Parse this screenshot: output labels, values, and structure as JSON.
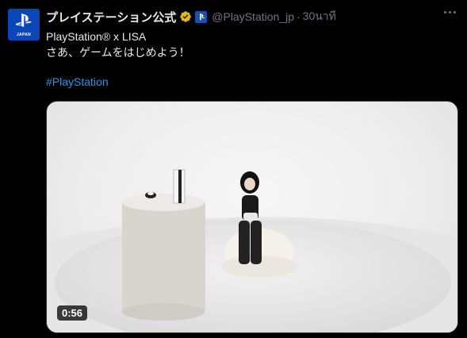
{
  "account": {
    "display_name": "プレイステーション公式",
    "handle": "@PlayStation_jp",
    "separator": "·",
    "time": "30นาที",
    "avatar_label": "JAPAN"
  },
  "tweet": {
    "lines": [
      "PlayStation® x LISA",
      "さあ、ゲームをはじめよう！"
    ],
    "hashtag": "#PlayStation"
  },
  "media": {
    "duration": "0:56"
  },
  "colors": {
    "background": "#000000",
    "text": "#e7e9ea",
    "secondary": "#71767b",
    "link": "#1d9bf0",
    "verified": "#e2b719",
    "avatar": "#0b47b8"
  }
}
